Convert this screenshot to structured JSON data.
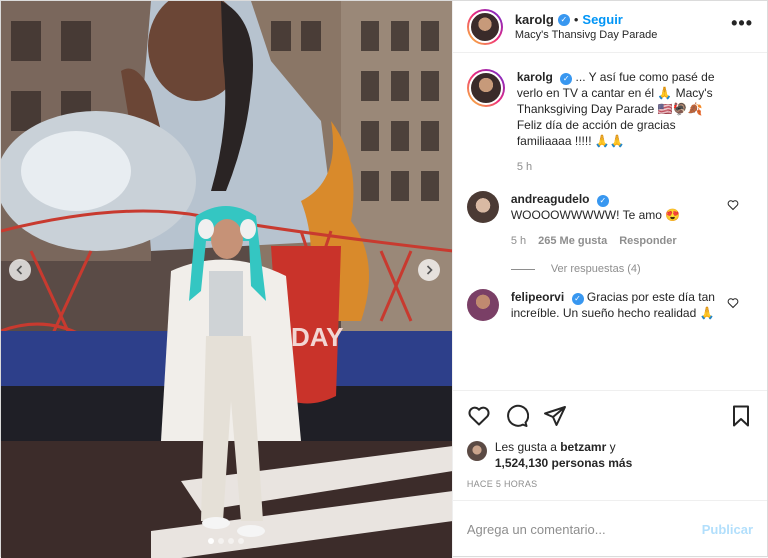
{
  "header": {
    "username": "karolg",
    "verified_icon": "verified-badge-icon",
    "separator": "•",
    "follow_label": "Seguir",
    "location": "Macy's Thansivg Day Parade",
    "more_icon": "more-options-icon"
  },
  "caption": {
    "username": "karolg",
    "text": "... Y así fue como pasé de verlo en TV a cantar en él 🙏 Macy's Thanksgiving Day Parade 🇺🇸🦃🍂 Feliz día de acción de gracias familiaaaa !!!!! 🙏🙏",
    "time": "5 h"
  },
  "comments": [
    {
      "username": "andreagudelo",
      "text": "WOOOOWWWWW! Te amo 😍",
      "time": "5 h",
      "likes": "265 Me gusta",
      "reply_label": "Responder",
      "view_replies": "Ver respuestas (4)"
    },
    {
      "username": "felipeorvi",
      "text": "Gracias por este día tan increíble. Un sueño hecho realidad 🙏"
    }
  ],
  "likes": {
    "prefix": "Les gusta a",
    "first_user": "betzamr",
    "conjunction": "y",
    "count": "1,524,130 personas más"
  },
  "timestamp": "HACE 5 HORAS",
  "add_comment": {
    "placeholder": "Agrega un comentario...",
    "publish_label": "Publicar"
  },
  "photo": {
    "float_sign_text": "DAY",
    "carousel_current": 1,
    "carousel_total": 4
  },
  "colors": {
    "link_blue": "#0095f6",
    "verified_blue": "#3897f0",
    "publish_disabled": "#b2dffc",
    "muted": "#8e8e8e"
  }
}
